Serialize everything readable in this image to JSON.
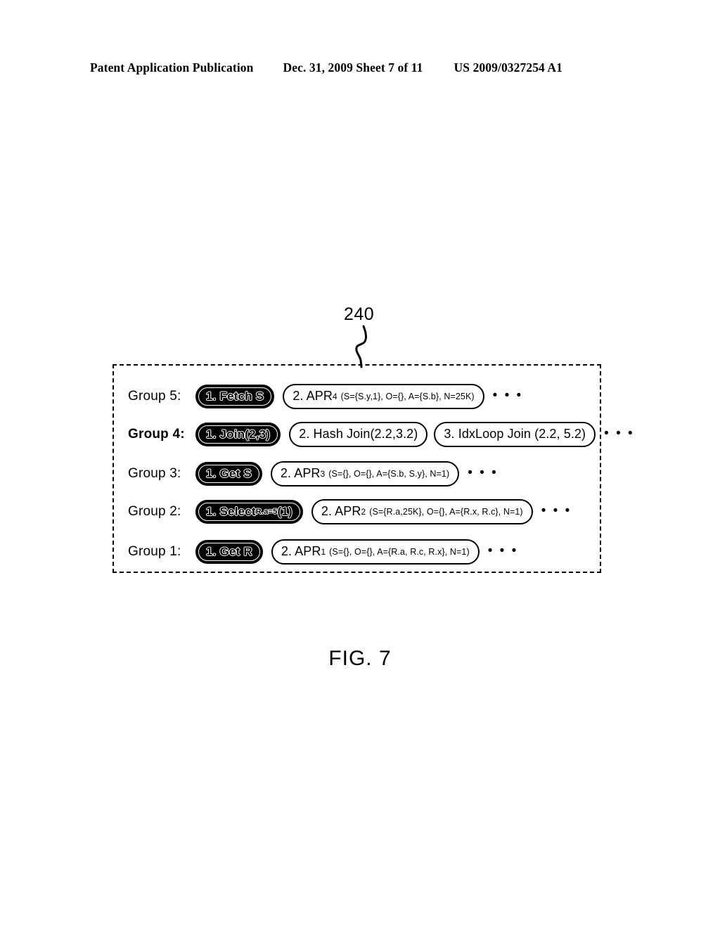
{
  "header": {
    "left": "Patent Application Publication",
    "middle": "Dec. 31, 2009  Sheet 7 of 11",
    "right": "US 2009/0327254 A1"
  },
  "figure": {
    "reference_number": "240",
    "caption": "FIG. 7",
    "ellipsis": "• • •",
    "rows": [
      {
        "label": "Group 5:",
        "items": [
          {
            "style": "solid",
            "text": "1. Fetch S"
          },
          {
            "style": "outline",
            "main": "2. APR",
            "sub": "4",
            "args": "(S={S.y,1}, O={}, A={S.b}, N=25K)"
          }
        ]
      },
      {
        "label": "Group 4:",
        "items": [
          {
            "style": "solid",
            "text": "1. Join(2,3)"
          },
          {
            "style": "outline",
            "main": "2. Hash Join(2.2,3.2)",
            "sub": "",
            "args": ""
          },
          {
            "style": "outline",
            "main": "3. IdxLoop Join (2.2, 5.2)",
            "sub": "",
            "args": ""
          }
        ]
      },
      {
        "label": "Group 3:",
        "items": [
          {
            "style": "solid",
            "text": "1. Get S"
          },
          {
            "style": "outline",
            "main": "2. APR",
            "sub": "3",
            "args": "(S={}, O={}, A={S.b, S.y}, N=1)"
          }
        ]
      },
      {
        "label": "Group 2:",
        "items": [
          {
            "style": "solid",
            "text": "1. Select",
            "subscript": "R.a=5",
            "suffix": "(1)"
          },
          {
            "style": "outline",
            "main": "2. APR",
            "sub": "2",
            "args": "(S={R.a,25K}, O={}, A={R.x, R.c}, N=1)"
          }
        ]
      },
      {
        "label": "Group 1:",
        "items": [
          {
            "style": "solid",
            "text": "1. Get R"
          },
          {
            "style": "outline",
            "main": "2. APR",
            "sub": "1",
            "args": "(S={}, O={}, A={R.a, R.c, R.x}, N=1)"
          }
        ]
      }
    ]
  },
  "colors": {
    "ink": "#000000",
    "page": "#ffffff"
  }
}
